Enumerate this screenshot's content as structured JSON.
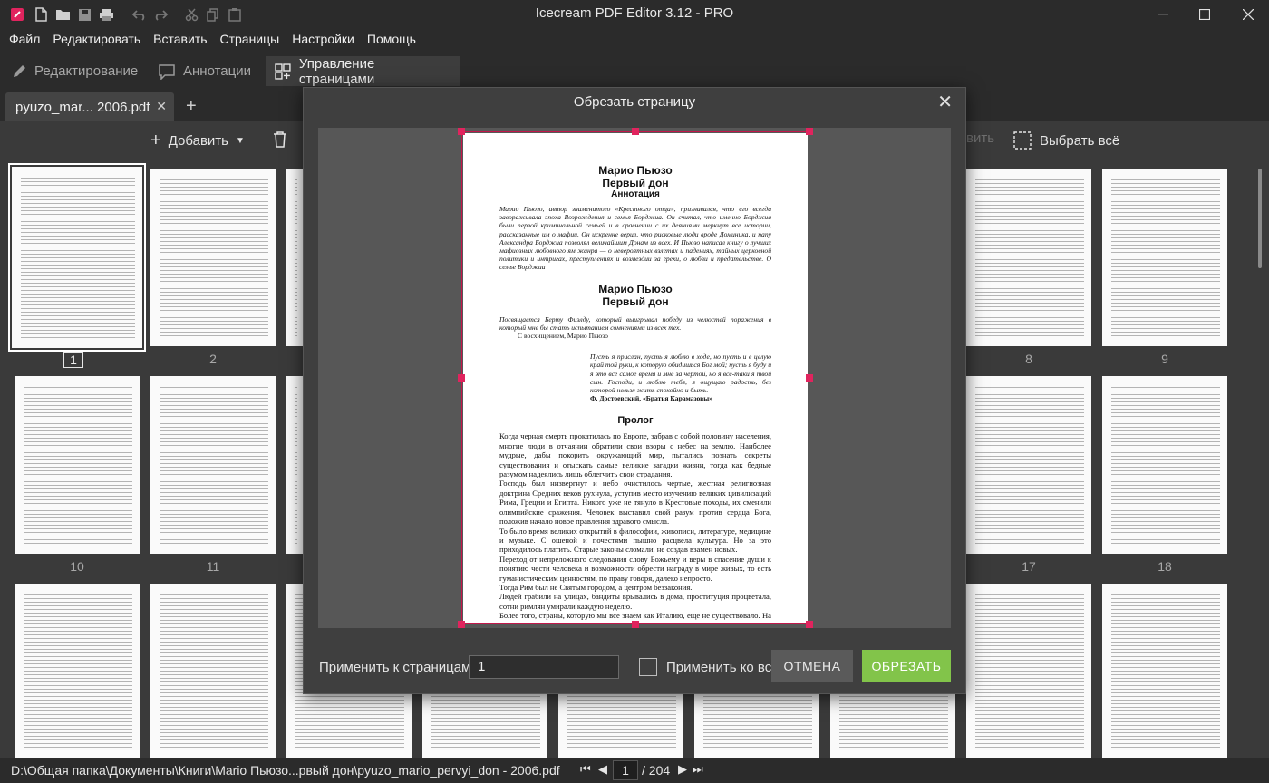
{
  "window": {
    "title": "Icecream PDF Editor 3.12 - PRO",
    "minimize_icon": "minimize-icon",
    "maximize_icon": "maximize-icon",
    "close_icon": "close-icon"
  },
  "menu": [
    "Файл",
    "Редактировать",
    "Вставить",
    "Страницы",
    "Настройки",
    "Помощь"
  ],
  "modes": {
    "edit": "Редактирование",
    "annotations": "Аннотации",
    "pages": "Управление страницами"
  },
  "tab": {
    "label": "pyuzo_mar... 2006.pdf"
  },
  "toolbar": {
    "add": "Добавить",
    "hidden_partial": "вить",
    "select_all": "Выбрать всё"
  },
  "thumbnails": {
    "row1_labels": [
      "1",
      "2",
      "8",
      "9"
    ],
    "row2_labels": [
      "10",
      "11",
      "17",
      "18"
    ]
  },
  "status": {
    "path": "D:\\Общая папка\\Документы\\Книги\\Мario Пьюзо...рвый дон\\pyuzo_mario_pervyi_don - 2006.pdf",
    "current_page": "1",
    "total_pages": "/ 204"
  },
  "dialog": {
    "title": "Обрезать страницу",
    "apply_label": "Применить к страницам:",
    "apply_value": "1",
    "apply_all_label": "Применить ко всем",
    "apply_all_checked": false,
    "cancel": "ОТМЕНА",
    "crop": "ОБРЕЗАТЬ",
    "accent": "#82c44a",
    "frame_color": "#e0245e"
  },
  "preview_page": {
    "title1": "Марио Пьюзо",
    "title2": "Первый дон",
    "subtitle": "Аннотация",
    "annotation": "Марио Пьюзо, автор знаменитого «Крестного отца», признавался, что его всегда завораживала эпоха Возрождения и семья Борджиа. Он считал, что именно Борджиа были первой криминальной семьей и в сравнении с их деяниями меркнут все истории, рассказанные им о мафии. Он искренне верил, что рисковые люди вроде Доминика, и папу Александра Борджиа позволял величайшим Донам из всех. И Пьюзо написал книгу о лучших мафиозных любовного ям жанра — о невероятных взлетах и падениях, тайных церковной политики и интригах, преступлениях и возмездии за грехи, о любви и предательстве. О семье Борджиа",
    "title3": "Марио Пьюзо",
    "title4": "Первый дон",
    "dedication": "Посвящается Берту Фиэлду, который выигрывал победу из челюстей поражения в который мне бы стать испытанием сомнениями из всех тех.",
    "dedication_sign": "С восхищением, Марио Пьюзо",
    "epigraph": "Пусть я прислан, пусть я люблю в ходе, но пусть и в целую край той руки, к которую обидишься Бог мой; пусть я буду и я это все самое время и мне за чертой, но я все-таки я твой сын. Господи, и люблю тебя, я ощущаю радость, без которой нельзя жить спокойно и быть.",
    "epigraph_sign": "Ф. Достоевский, «Братья Карамазовы»",
    "prologue_title": "Пролог",
    "prologue1": "Когда черная смерть прокатилась по Европе, забрав с собой половину населения, многие люди в отчаянии обратили свои взоры с небес на землю. Наиболее мудрые, дабы покорить окружающий мир, пытались познать секреты существования и отыскать самые великие загадки жизни, тогда как бедные разумом надеялись лишь облегчить свои страдания.",
    "prologue2": "Господь был низвергнут и небо очистилось чертые, жестная религиозная доктрина Средних веков рухнула, уступив место изучению великих цивилизаций Рима, Греции и Египта. Никого уже не тянуло в Крестовые походы, их сменили олимпийские сражения. Человек выставил свой разум против сердца Бога, положив начало новое правления здравого смысла.",
    "prologue3": "То было время великих открытий в философии, живописи, литературе, медицине и музыке. С ошеной и почестями пышно расцвела культура. Но за это приходилось платить. Старые законы сломали, не создав взамен новых.",
    "prologue4": "Переход от непреложного следования слову Божьему и веры в спасение души к понятию чести человека и возможности обрести награду в мире живых, то есть гуманистическим ценностям, по праву говоря, далеко непросто.",
    "prologue5": "Тогда Рим был не Святым городом, а центром беззакония.",
    "prologue6": "Людей грабили на улицах, бандиты врывались в дома, проституция процветала, сотни римлян умирали каждую неделю.",
    "prologue7": "Более того, страны, которую мы все знаем как Италию, еще не существовало. На ее территории располагались пять небольших государств: Венеция, Милан, Флоренция,"
  }
}
